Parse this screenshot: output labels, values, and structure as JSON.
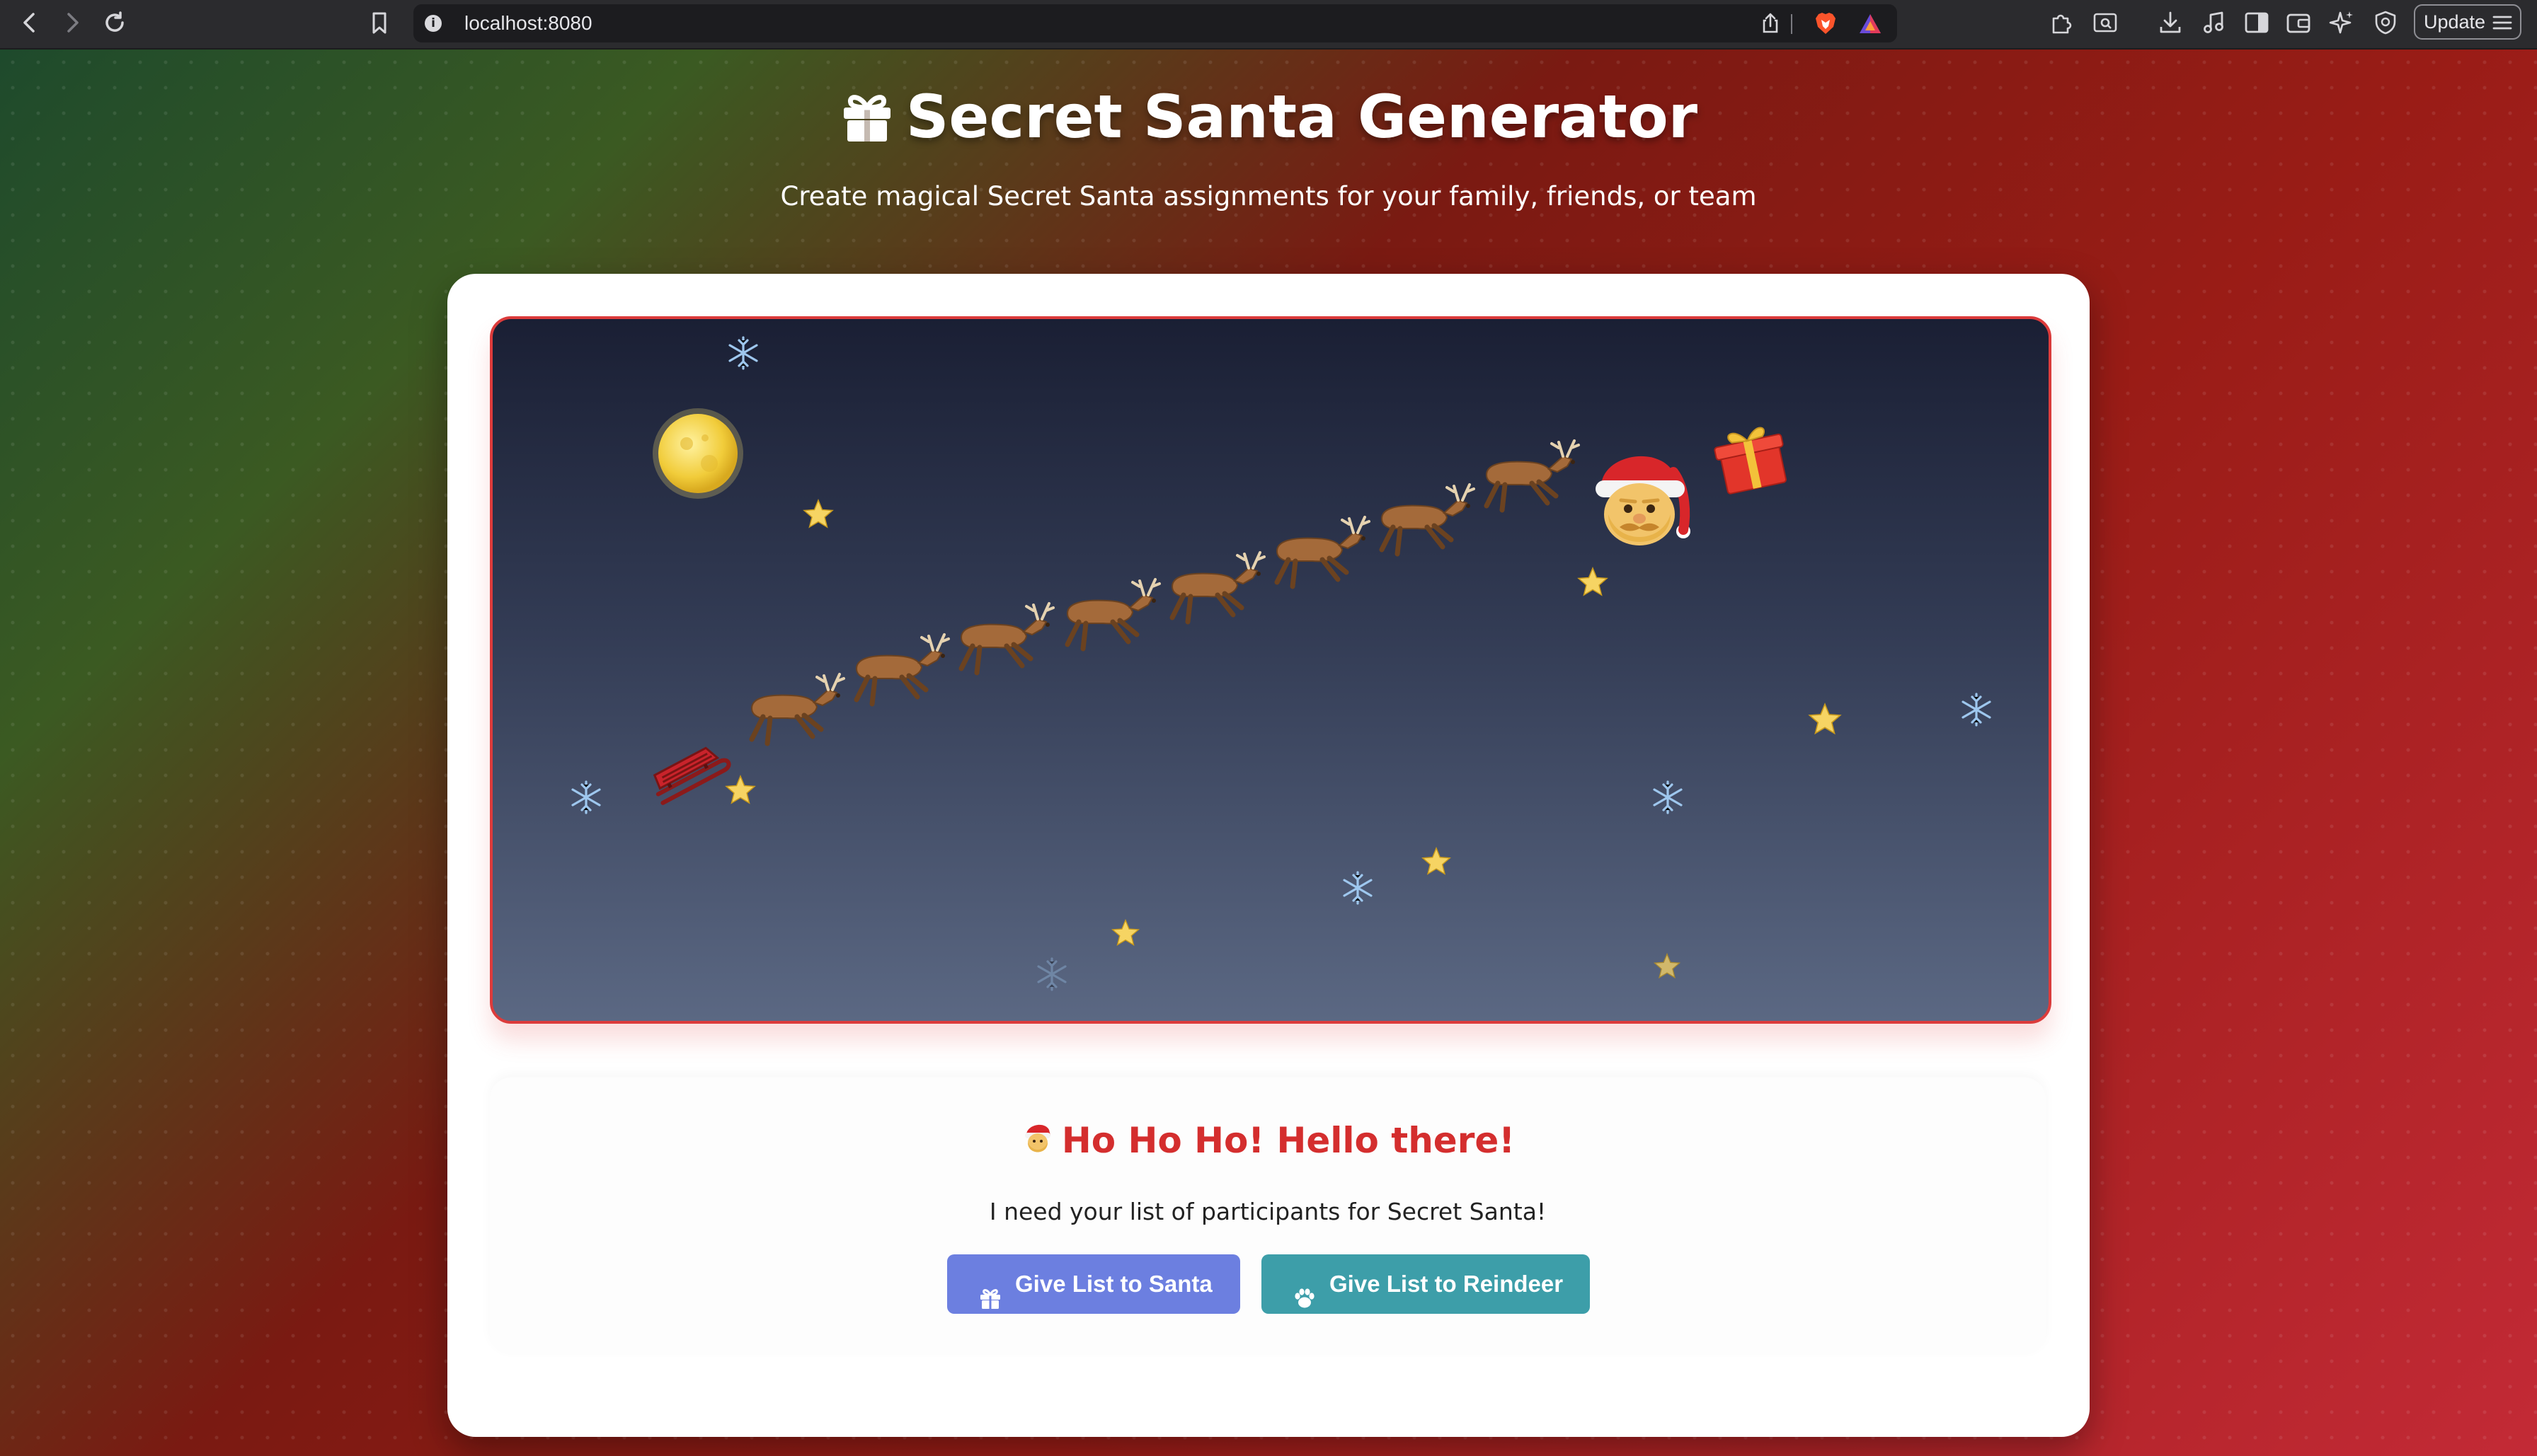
{
  "browser": {
    "url": "localhost:8080",
    "update_label": "Update",
    "icons": [
      "back-icon",
      "forward-icon",
      "reload-icon",
      "bookmark-icon",
      "info-icon",
      "share-icon",
      "brave-shield-icon",
      "brave-rewards-icon",
      "extensions-icon",
      "screenshot-icon",
      "downloads-icon",
      "media-icon",
      "sidebar-icon",
      "wallet-icon",
      "leo-ai-icon",
      "vpn-icon",
      "menu-icon"
    ]
  },
  "header": {
    "title": "Secret Santa Generator",
    "subtitle": "Create magical Secret Santa assignments for your family, friends, or team"
  },
  "scene": {
    "icons": [
      "moon-icon",
      "sleigh-icon",
      "reindeer-icon",
      "santa-icon",
      "gift-icon",
      "star-icon",
      "snowflake-icon"
    ],
    "reindeer_count": 8
  },
  "panel": {
    "greeting": "Ho Ho Ho! Hello there!",
    "message": "I need your list of participants for Secret Santa!",
    "buttons": {
      "santa": "Give List to Santa",
      "reindeer": "Give List to Reindeer"
    }
  },
  "colors": {
    "accent_red": "#d42e2e",
    "santa_button": "#6c7fe0",
    "reindeer_button": "#3d9ea9",
    "scene_border": "#dc3b3b"
  }
}
